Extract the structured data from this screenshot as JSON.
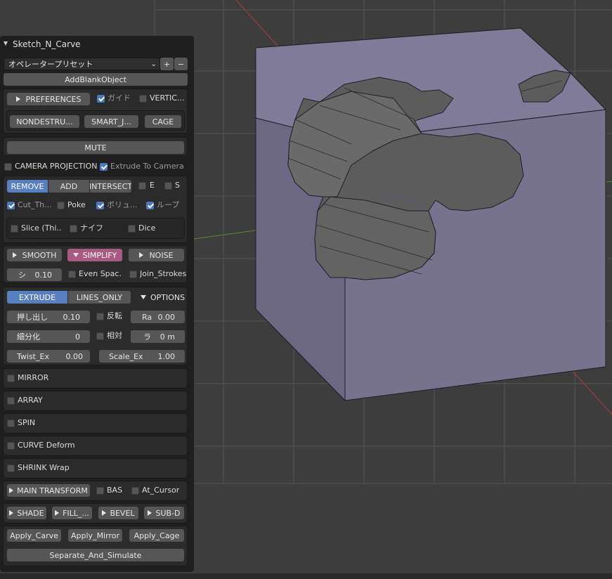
{
  "panel": {
    "title": "Sketch_N_Carve",
    "preset": {
      "value": "オペレータープリセット",
      "add_label": "+",
      "remove_label": "−"
    },
    "add_blank_label": "AddBlankObject",
    "preferences_label": "PREFERENCES",
    "guide_label": "ガイド",
    "vertic_label": "VERTIC...",
    "modes": [
      "NONDESTRU...",
      "SMART_J...",
      "CAGE"
    ],
    "mute_label": "MUTE",
    "camera_projection_label": "CAMERA PROJECTION",
    "extrude_to_camera_label": "Extrude To Camera",
    "bool_ops": [
      "REMOVE",
      "ADD",
      "INTERSECT"
    ],
    "e_label": "E",
    "s_label": "S",
    "cut_through_label": "Cut_Th...",
    "poke_label": "Poke",
    "volume_label": "ボリュ...",
    "loop_label": "ループ",
    "slice_label": "Slice (Thi...",
    "knife_label": "ナイフ",
    "dice_label": "Dice",
    "smooth_label": "SMOOTH",
    "simplify_label": "SIMPLIFY",
    "noise_label": "NOISE",
    "simplify_field": {
      "label": "シ",
      "value": "0.10"
    },
    "even_spacing_label": "Even Spac...",
    "join_strokes_label": "Join_Strokes",
    "extrude_label": "EXTRUDE",
    "lines_only_label": "LINES_ONLY",
    "options_label": "OPTIONS",
    "extrude_field": {
      "label": "押し出し",
      "value": "0.10"
    },
    "invert_label": "反転",
    "ra_field": {
      "label": "Ra",
      "value": "0.00"
    },
    "subdiv_field": {
      "label": "細分化",
      "value": "0"
    },
    "relative_label": "相対",
    "ra2_field": {
      "label": "ラ",
      "value": "0 m"
    },
    "twist_field": {
      "label": "Twist_Ex",
      "value": "0.00"
    },
    "scale_field": {
      "label": "Scale_Ex",
      "value": "1.00"
    },
    "mirror_label": "MIRROR",
    "array_label": "ARRAY",
    "spin_label": "SPIN",
    "curve_label": "CURVE Deform",
    "shrink_label": "SHRINK Wrap",
    "main_transform_label": "MAIN TRANSFORM",
    "bas_label": "BAS",
    "at_cursor_label": "At_Cursor",
    "shade_label": "SHADE",
    "fill_label": "FILL_...",
    "bevel_label": "BEVEL",
    "subd_label": "SUB-D",
    "apply_carve_label": "Apply_Carve",
    "apply_mirror_label": "Apply_Mirror",
    "apply_cage_label": "Apply_Cage",
    "separate_label": "Separate_And_Simulate"
  },
  "colors": {
    "viewport_bg": "#3d3d3d",
    "grid": "#565656",
    "x_axis": "#a33a3a",
    "y_axis": "#5b8a2d",
    "cube_face": "#77738f",
    "cube_face_dark": "#6c6883",
    "cut_interior": "#5a5a5a",
    "accent_blue": "#5680c2",
    "accent_pink": "#a85a82"
  }
}
